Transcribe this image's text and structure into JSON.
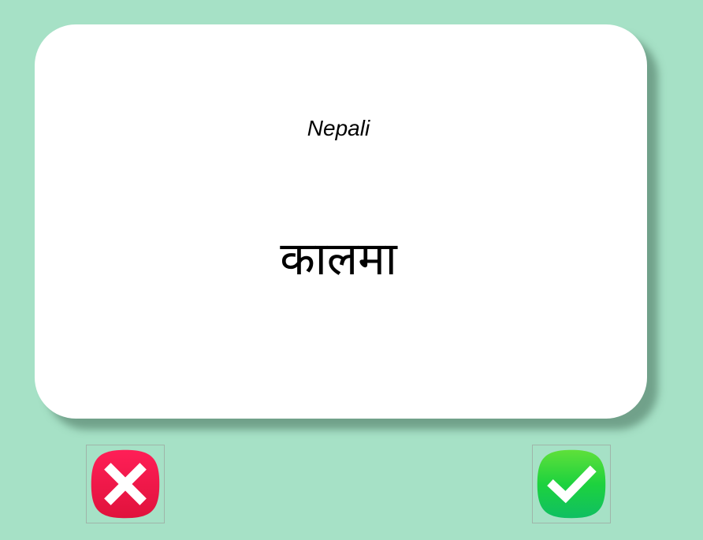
{
  "card": {
    "language": "Nepali",
    "word": "कालमा"
  },
  "buttons": {
    "wrong_icon": "close-icon",
    "correct_icon": "checkmark-icon",
    "wrong_color": "#e8164a",
    "correct_color": "#16c94a"
  },
  "colors": {
    "background": "#a6e1c6",
    "card": "#ffffff"
  }
}
